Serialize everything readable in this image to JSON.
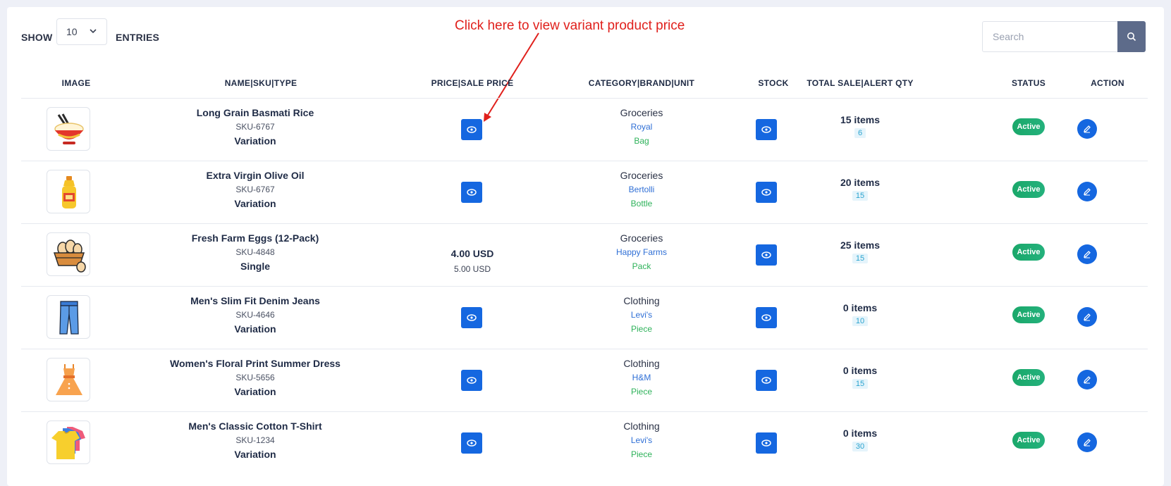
{
  "controls": {
    "show_label": "SHOW",
    "page_size": "10",
    "entries_label": "ENTRIES",
    "search_placeholder": "Search",
    "search_icon": "search-icon"
  },
  "annotation": {
    "text": "Click here to view variant product price",
    "color": "#e0201c"
  },
  "table": {
    "headers": {
      "image": "IMAGE",
      "name": "NAME|SKU|TYPE",
      "price": "PRICE|SALE PRICE",
      "category": "CATEGORY|BRAND|UNIT",
      "stock": "STOCK",
      "sale": "TOTAL SALE|ALERT QTY",
      "status": "STATUS",
      "action": "ACTION"
    },
    "rows": [
      {
        "image_icon": "rice-bowl-icon",
        "name": "Long Grain Basmati Rice",
        "sku": "SKU-6767",
        "type": "Variation",
        "price": "",
        "sale_price": "",
        "category": "Groceries",
        "brand": "Royal",
        "unit": "Bag",
        "total_sale": "15 items",
        "alert_qty": "6",
        "status": "Active"
      },
      {
        "image_icon": "olive-oil-icon",
        "name": "Extra Virgin Olive Oil",
        "sku": "SKU-6767",
        "type": "Variation",
        "price": "",
        "sale_price": "",
        "category": "Groceries",
        "brand": "Bertolli",
        "unit": "Bottle",
        "total_sale": "20 items",
        "alert_qty": "15",
        "status": "Active"
      },
      {
        "image_icon": "egg-basket-icon",
        "name": "Fresh Farm Eggs (12-Pack)",
        "sku": "SKU-4848",
        "type": "Single",
        "price": "4.00 USD",
        "sale_price": "5.00 USD",
        "category": "Groceries",
        "brand": "Happy Farms",
        "unit": "Pack",
        "total_sale": "25 items",
        "alert_qty": "15",
        "status": "Active"
      },
      {
        "image_icon": "jeans-icon",
        "name": "Men's Slim Fit Denim Jeans",
        "sku": "SKU-4646",
        "type": "Variation",
        "price": "",
        "sale_price": "",
        "category": "Clothing",
        "brand": "Levi's",
        "unit": "Piece",
        "total_sale": "0 items",
        "alert_qty": "10",
        "status": "Active"
      },
      {
        "image_icon": "dress-icon",
        "name": "Women's Floral Print Summer Dress",
        "sku": "SKU-5656",
        "type": "Variation",
        "price": "",
        "sale_price": "",
        "category": "Clothing",
        "brand": "H&M",
        "unit": "Piece",
        "total_sale": "0 items",
        "alert_qty": "15",
        "status": "Active"
      },
      {
        "image_icon": "tshirt-icon",
        "name": "Men's Classic Cotton T-Shirt",
        "sku": "SKU-1234",
        "type": "Variation",
        "price": "",
        "sale_price": "",
        "category": "Clothing",
        "brand": "Levi's",
        "unit": "Piece",
        "total_sale": "0 items",
        "alert_qty": "30",
        "status": "Active"
      }
    ]
  },
  "colors": {
    "primary": "#1567e0",
    "status_active": "#1aa86a",
    "brand_link": "#2f6fd6",
    "unit_text": "#2eb25a",
    "alert_badge_bg": "#e5f4fb"
  }
}
